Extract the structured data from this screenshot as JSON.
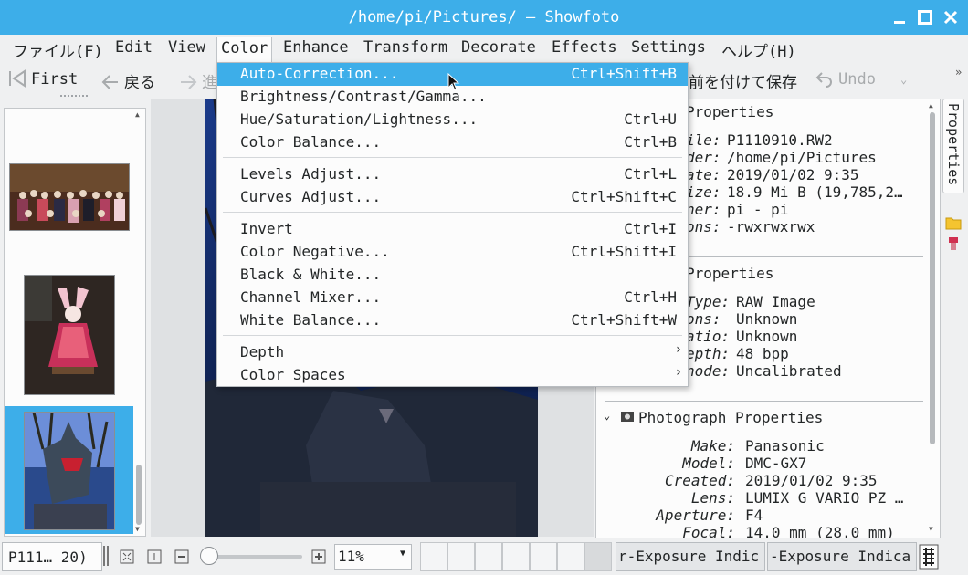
{
  "window": {
    "title": "/home/pi/Pictures/ — Showfoto"
  },
  "menubar": [
    "ファイル(F)",
    "Edit",
    "View",
    "Color",
    "Enhance",
    "Transform",
    "Decorate",
    "Effects",
    "Settings",
    "ヘルプ(H)"
  ],
  "toolbar": {
    "first": "First",
    "back": "戻る",
    "forward": "進",
    "save_as": "前を付けて保存",
    "undo": "Undo"
  },
  "color_menu": {
    "auto_correction": {
      "label": "Auto-Correction...",
      "shortcut": "Ctrl+Shift+B"
    },
    "bcg": {
      "label": "Brightness/Contrast/Gamma...",
      "shortcut": ""
    },
    "hsl": {
      "label": "Hue/Saturation/Lightness...",
      "shortcut": "Ctrl+U"
    },
    "color_balance": {
      "label": "Color Balance...",
      "shortcut": "Ctrl+B"
    },
    "levels": {
      "label": "Levels Adjust...",
      "shortcut": "Ctrl+L"
    },
    "curves": {
      "label": "Curves Adjust...",
      "shortcut": "Ctrl+Shift+C"
    },
    "invert": {
      "label": "Invert",
      "shortcut": "Ctrl+I"
    },
    "negative": {
      "label": "Color Negative...",
      "shortcut": "Ctrl+Shift+I"
    },
    "bw": {
      "label": "Black & White...",
      "shortcut": ""
    },
    "mixer": {
      "label": "Channel Mixer...",
      "shortcut": "Ctrl+H"
    },
    "wb": {
      "label": "White Balance...",
      "shortcut": "Ctrl+Shift+W"
    },
    "depth": {
      "label": "Depth",
      "shortcut": ""
    },
    "spaces": {
      "label": "Color Spaces",
      "shortcut": ""
    }
  },
  "file_properties": {
    "header": "Properties",
    "rows": [
      {
        "label": "ile:",
        "value": "P1110910.RW2"
      },
      {
        "label": "der:",
        "value": "/home/pi/Pictures"
      },
      {
        "label": "ate:",
        "value": "2019/01/02 9:35"
      },
      {
        "label": "ize:",
        "value": "18.9 Mi B (19,785,2…"
      },
      {
        "label": "ner:",
        "value": "pi - pi"
      },
      {
        "label": "ons:",
        "value": "-rwxrwxrwx"
      }
    ]
  },
  "image_properties": {
    "header": "Properties",
    "rows": [
      {
        "label": "Type:",
        "value": "RAW Image"
      },
      {
        "label": "ons:",
        "value": "Unknown"
      },
      {
        "label": "atio:",
        "value": "Unknown"
      },
      {
        "label": "epth:",
        "value": "48 bpp"
      },
      {
        "label": "node:",
        "value": "Uncalibrated"
      }
    ]
  },
  "photo_properties": {
    "header": "Photograph Properties",
    "rows": [
      {
        "label": "Make:",
        "value": "Panasonic"
      },
      {
        "label": "Model:",
        "value": "DMC-GX7"
      },
      {
        "label": "Created:",
        "value": "2019/01/02 9:35"
      },
      {
        "label": "Lens:",
        "value": "LUMIX G VARIO PZ …"
      },
      {
        "label": "Aperture:",
        "value": "F4"
      },
      {
        "label": "Focal:",
        "value": "14.0 mm (28.0 mm)"
      }
    ]
  },
  "side_tab": "Properties",
  "status": {
    "filename": "P111… 20)",
    "zoom": "11%",
    "under_exposure": "r-Exposure Indic",
    "over_exposure": "-Exposure Indica"
  },
  "colors": {
    "accent": "#3daee9",
    "background": "#eff0f1",
    "panel": "#fcfcfc"
  },
  "icons": [
    "first-icon",
    "back-icon",
    "forward-icon",
    "undo-icon",
    "minimize-icon",
    "maximize-icon",
    "close-icon",
    "folder-icon",
    "tag-icon",
    "mouse-cursor-icon"
  ]
}
